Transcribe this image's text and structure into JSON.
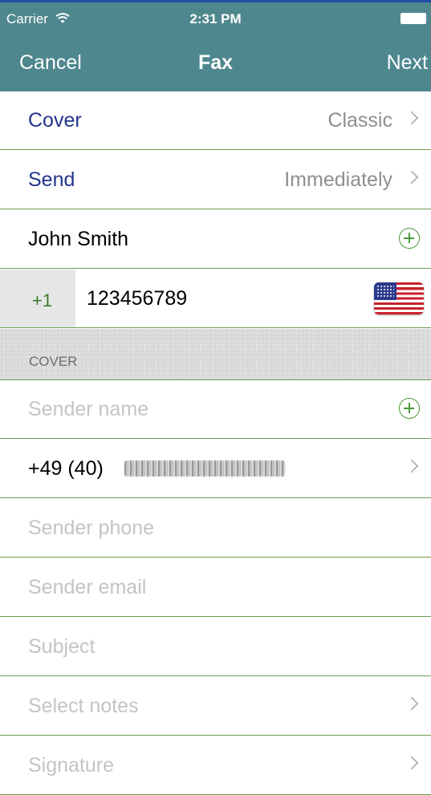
{
  "status_bar": {
    "carrier": "Carrier",
    "time": "2:31 PM"
  },
  "nav": {
    "left": "Cancel",
    "title": "Fax",
    "right": "Next"
  },
  "cover_row": {
    "label": "Cover",
    "value": "Classic"
  },
  "send_row": {
    "label": "Send",
    "value": "Immediately"
  },
  "recipient": {
    "name": "John Smith",
    "country_code": "+1",
    "number": "123456789",
    "flag": "us-flag"
  },
  "section": {
    "title": "COVER"
  },
  "sender_fax": {
    "prefix": "+49 (40)"
  },
  "fields": {
    "sender_name": "Sender name",
    "sender_phone": "Sender phone",
    "sender_email": "Sender email",
    "subject": "Subject",
    "select_notes": "Select notes",
    "signature": "Signature"
  },
  "colors": {
    "navbar": "#4f878f",
    "separator": "#6f9c4a",
    "accent": "#4b9a3a",
    "label_blue": "#23358c"
  },
  "icons": {
    "wifi": "wifi-icon",
    "battery": "battery-icon",
    "chevron": "chevron-right-icon",
    "add": "add-circle-icon"
  }
}
